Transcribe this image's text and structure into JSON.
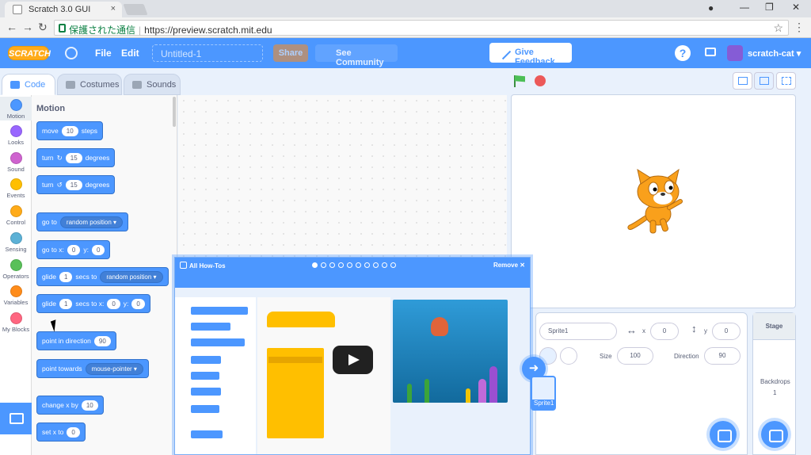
{
  "browser": {
    "tab_title": "Scratch 3.0 GUI",
    "tab_close": "×",
    "security_text": "保護された通信",
    "url": "https://preview.scratch.mit.edu",
    "back": "←",
    "forward": "→",
    "reload": "↻",
    "star": "☆",
    "menu": "⋮",
    "account": "●",
    "minimize": "—",
    "restore": "❐",
    "close": "✕"
  },
  "menubar": {
    "logo": "SCRATCH",
    "file": "File",
    "edit": "Edit",
    "project_title": "Untitled-1",
    "share": "Share",
    "see_community": "See Community",
    "give_feedback": "Give Feedback",
    "help": "?",
    "username": "scratch-cat",
    "username_caret": "▾"
  },
  "tabs": {
    "code": "Code",
    "costumes": "Costumes",
    "sounds": "Sounds"
  },
  "categories": [
    {
      "label": "Motion",
      "color": "#4c97ff"
    },
    {
      "label": "Looks",
      "color": "#9966ff"
    },
    {
      "label": "Sound",
      "color": "#cf63cf"
    },
    {
      "label": "Events",
      "color": "#ffbf00"
    },
    {
      "label": "Control",
      "color": "#ffab19"
    },
    {
      "label": "Sensing",
      "color": "#5cb1d6"
    },
    {
      "label": "Operators",
      "color": "#59c059"
    },
    {
      "label": "Variables",
      "color": "#ff8c1a"
    },
    {
      "label": "My Blocks",
      "color": "#ff6680"
    }
  ],
  "palette": {
    "heading": "Motion",
    "move": {
      "pre": "move",
      "val": "10",
      "post": "steps"
    },
    "turn_right": {
      "pre": "turn",
      "icon": "↻",
      "val": "15",
      "post": "degrees"
    },
    "turn_left": {
      "pre": "turn",
      "icon": "↺",
      "val": "15",
      "post": "degrees"
    },
    "goto": {
      "pre": "go to",
      "drop": "random position ▾"
    },
    "goto_xy": {
      "pre": "go to x:",
      "x": "0",
      "ylabel": "y:",
      "y": "0"
    },
    "glide": {
      "pre": "glide",
      "val": "1",
      "mid": "secs to",
      "drop": "random position ▾"
    },
    "glide_xy": {
      "pre": "glide",
      "val": "1",
      "mid": "secs to x:",
      "x": "0",
      "ylabel": "y:",
      "y": "0"
    },
    "point_dir": {
      "pre": "point in direction",
      "val": "90"
    },
    "point_towards": {
      "pre": "point towards",
      "drop": "mouse-pointer ▾"
    },
    "change_x": {
      "pre": "change x by",
      "val": "10"
    },
    "set_x": {
      "pre": "set x to",
      "val": "0"
    }
  },
  "sprite_info": {
    "sprite_label": "Sprite1",
    "x_label": "x",
    "x_value": "0",
    "y_label": "y",
    "y_value": "0",
    "size_label": "Size",
    "size_value": "100",
    "direction_label": "Direction",
    "direction_value": "90",
    "thumb_name": "Sprite1"
  },
  "stage_panel": {
    "heading": "Stage",
    "backdrops_label": "Backdrops",
    "backdrops_count": "1"
  },
  "howto": {
    "title": "All How-Tos",
    "remove": "Remove",
    "remove_icon": "✕",
    "steps_total": 10,
    "step_active": 1
  },
  "overlay_arrow": "➜"
}
